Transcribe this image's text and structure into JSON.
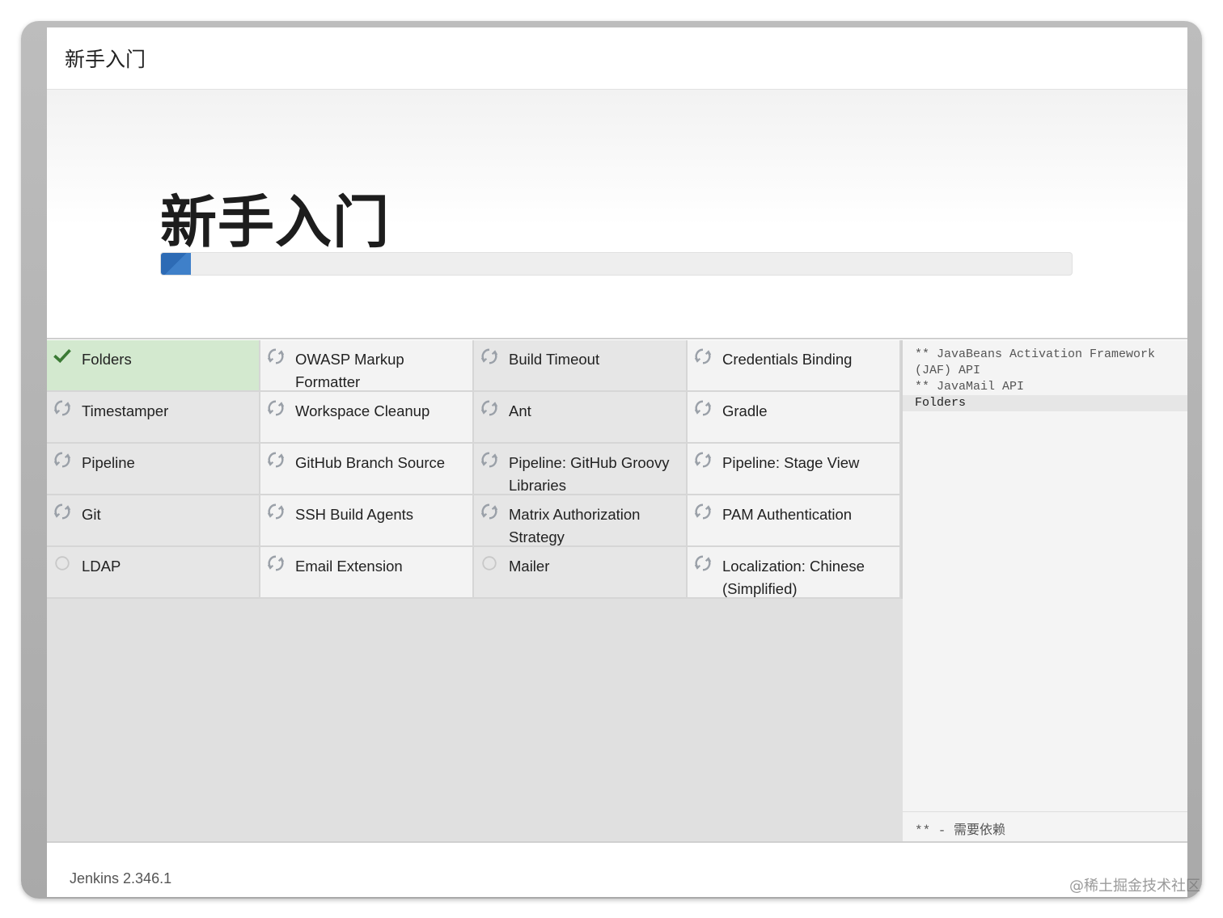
{
  "header": {
    "title": "新手入门"
  },
  "hero": {
    "title": "新手入门",
    "progress_fraction": 0.033
  },
  "plugins": [
    {
      "label": "Folders",
      "status": "done"
    },
    {
      "label": "OWASP Markup Formatter",
      "status": "installing"
    },
    {
      "label": "Build Timeout",
      "status": "installing"
    },
    {
      "label": "Credentials Binding",
      "status": "installing"
    },
    {
      "label": "Timestamper",
      "status": "installing"
    },
    {
      "label": "Workspace Cleanup",
      "status": "installing"
    },
    {
      "label": "Ant",
      "status": "installing"
    },
    {
      "label": "Gradle",
      "status": "installing"
    },
    {
      "label": "Pipeline",
      "status": "installing"
    },
    {
      "label": "GitHub Branch Source",
      "status": "installing"
    },
    {
      "label": "Pipeline: GitHub Groovy Libraries",
      "status": "installing"
    },
    {
      "label": "Pipeline: Stage View",
      "status": "installing"
    },
    {
      "label": "Git",
      "status": "installing"
    },
    {
      "label": "SSH Build Agents",
      "status": "installing"
    },
    {
      "label": "Matrix Authorization Strategy",
      "status": "installing"
    },
    {
      "label": "PAM Authentication",
      "status": "installing"
    },
    {
      "label": "LDAP",
      "status": "pending"
    },
    {
      "label": "Email Extension",
      "status": "installing"
    },
    {
      "label": "Mailer",
      "status": "pending"
    },
    {
      "label": "Localization: Chinese (Simplified)",
      "status": "installing"
    }
  ],
  "status_icons": {
    "done": "check-icon",
    "installing": "refresh-spinner-icon",
    "pending": "empty-circle-icon"
  },
  "colors": {
    "done_bg": "#d3e9cf",
    "check": "#3a7a34",
    "progress": "#2d6bb5"
  },
  "log": {
    "lines": [
      "** JavaBeans Activation Framework (JAF) API",
      "** JavaMail API",
      "Folders"
    ],
    "highlighted_index": 2
  },
  "legend": {
    "marker": "** -",
    "text": "需要依赖"
  },
  "footer": {
    "version": "Jenkins 2.346.1"
  },
  "watermark": "@稀土掘金技术社区"
}
